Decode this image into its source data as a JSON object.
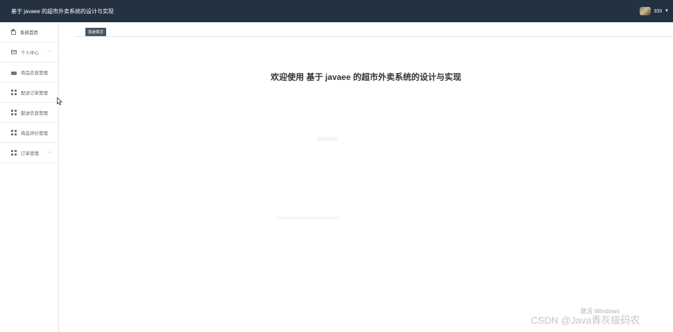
{
  "header": {
    "title": "基于 javaee 的超市外卖系统的设计与实现",
    "username": "333"
  },
  "sidebar": {
    "items": [
      {
        "label": "系统首页",
        "icon": "home-icon",
        "expandable": false
      },
      {
        "label": "个人中心",
        "icon": "card-icon",
        "expandable": true
      },
      {
        "label": "商品信息管理",
        "icon": "box-icon",
        "expandable": false
      },
      {
        "label": "配送订单管理",
        "icon": "grid-icon",
        "expandable": false
      },
      {
        "label": "配送信息管理",
        "icon": "grid-icon",
        "expandable": false
      },
      {
        "label": "商品评价管理",
        "icon": "grid-icon",
        "expandable": false
      },
      {
        "label": "订单管理",
        "icon": "grid-icon",
        "expandable": true
      }
    ]
  },
  "main": {
    "breadcrumb": "系统首页",
    "welcome": "欢迎使用 基于 javaee 的超市外卖系统的设计与实现"
  },
  "watermark": {
    "windows": "激活 Windows",
    "csdn": "CSDN @Java青灰级码农"
  },
  "colors": {
    "header_bg": "#243140",
    "breadcrumb_bg": "#4a5562",
    "sidebar_text": "#5b6470"
  }
}
